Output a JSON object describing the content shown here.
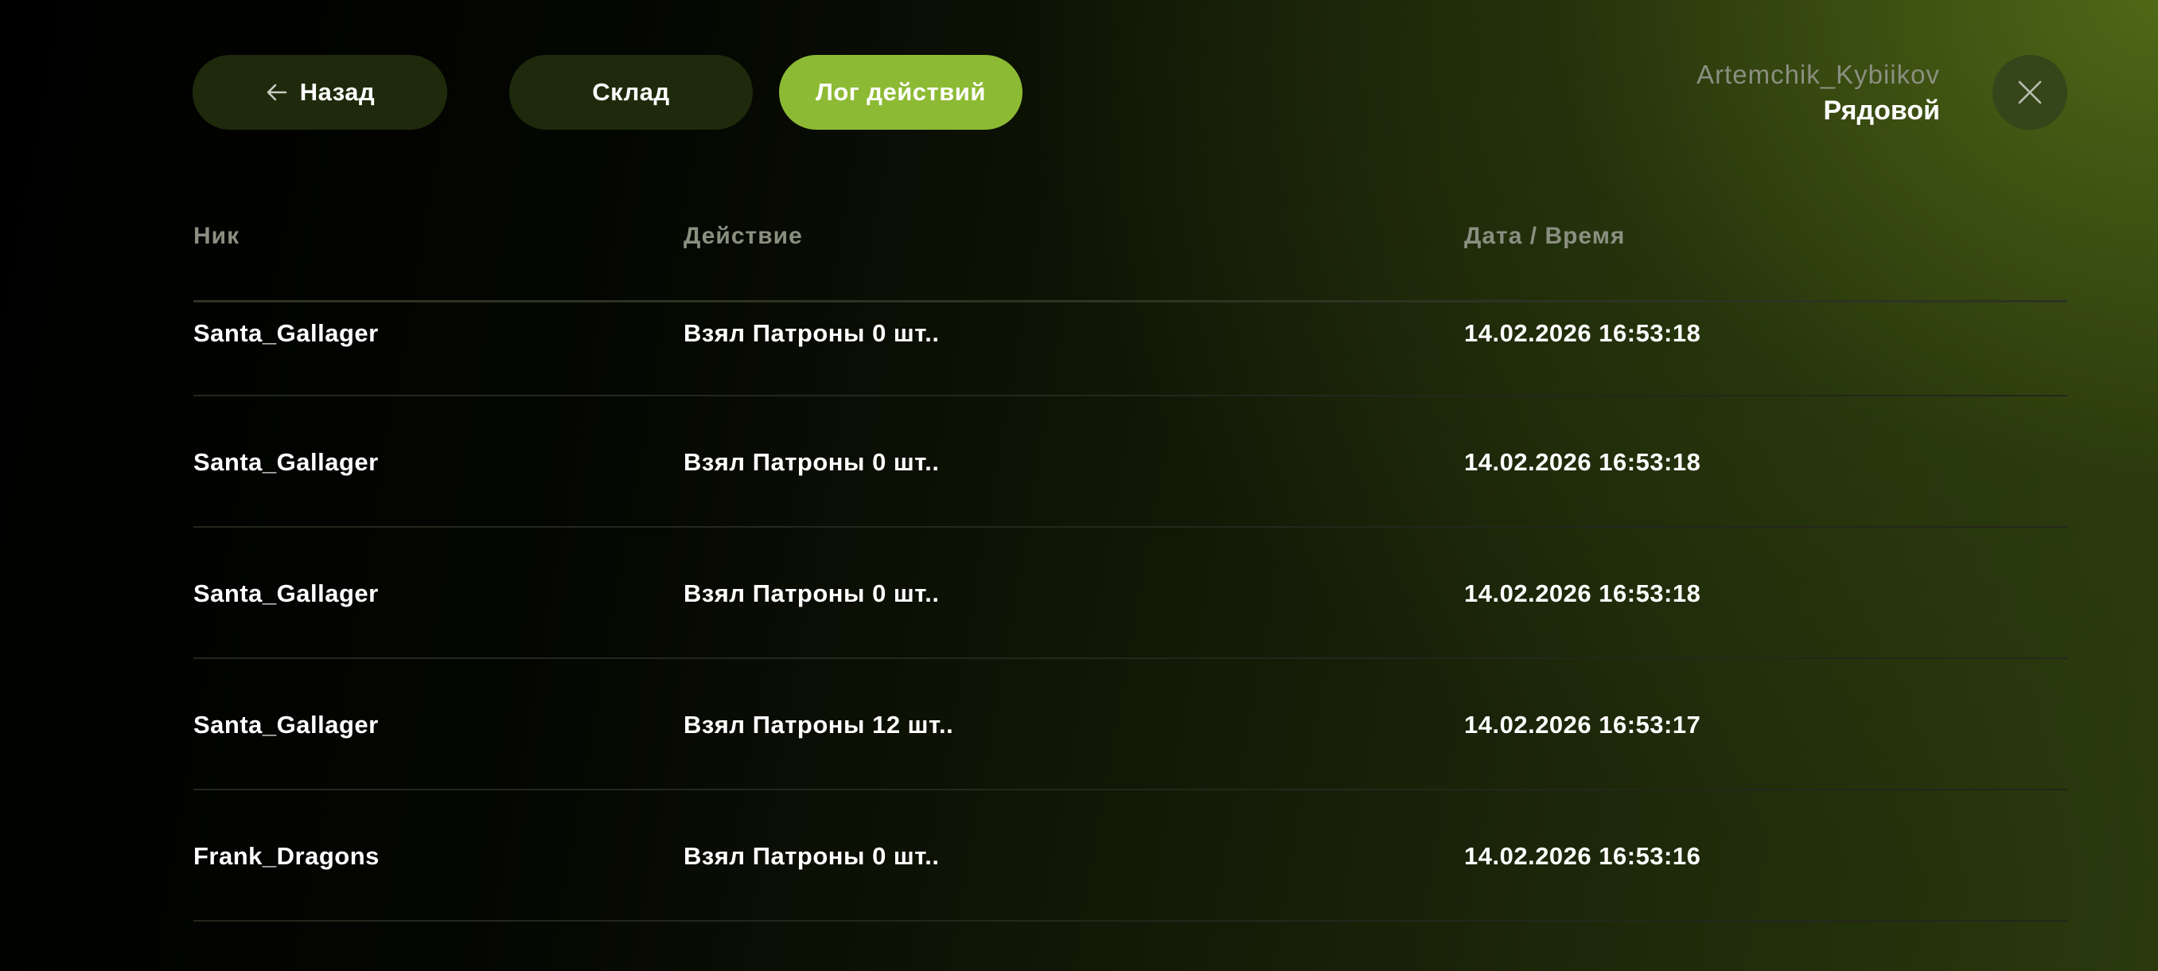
{
  "nav": {
    "back_label": "Назад",
    "stock_label": "Склад",
    "log_label": "Лог действий",
    "active_tab": "log"
  },
  "user": {
    "name": "Artemchik_Kybiikov",
    "rank": "Рядовой"
  },
  "icons": {
    "back": "arrow-left-icon",
    "close": "close-icon"
  },
  "colors": {
    "accent": "#8dba34",
    "pill_dark": "#1e2a0b",
    "muted_text": "#8a8f80"
  },
  "table": {
    "headers": {
      "nick": "Ник",
      "action": "Действие",
      "datetime": "Дата / Время"
    },
    "rows": [
      {
        "nick": "Santa_Gallager",
        "action": "Взял Патроны 0 шт..",
        "datetime": "14.02.2026 16:53:18"
      },
      {
        "nick": "Santa_Gallager",
        "action": "Взял Патроны 0 шт..",
        "datetime": "14.02.2026 16:53:18"
      },
      {
        "nick": "Santa_Gallager",
        "action": "Взял Патроны 0 шт..",
        "datetime": "14.02.2026 16:53:18"
      },
      {
        "nick": "Santa_Gallager",
        "action": "Взял Патроны 12 шт..",
        "datetime": "14.02.2026 16:53:17"
      },
      {
        "nick": "Frank_Dragons",
        "action": "Взял Патроны 0 шт..",
        "datetime": "14.02.2026 16:53:16"
      }
    ]
  }
}
